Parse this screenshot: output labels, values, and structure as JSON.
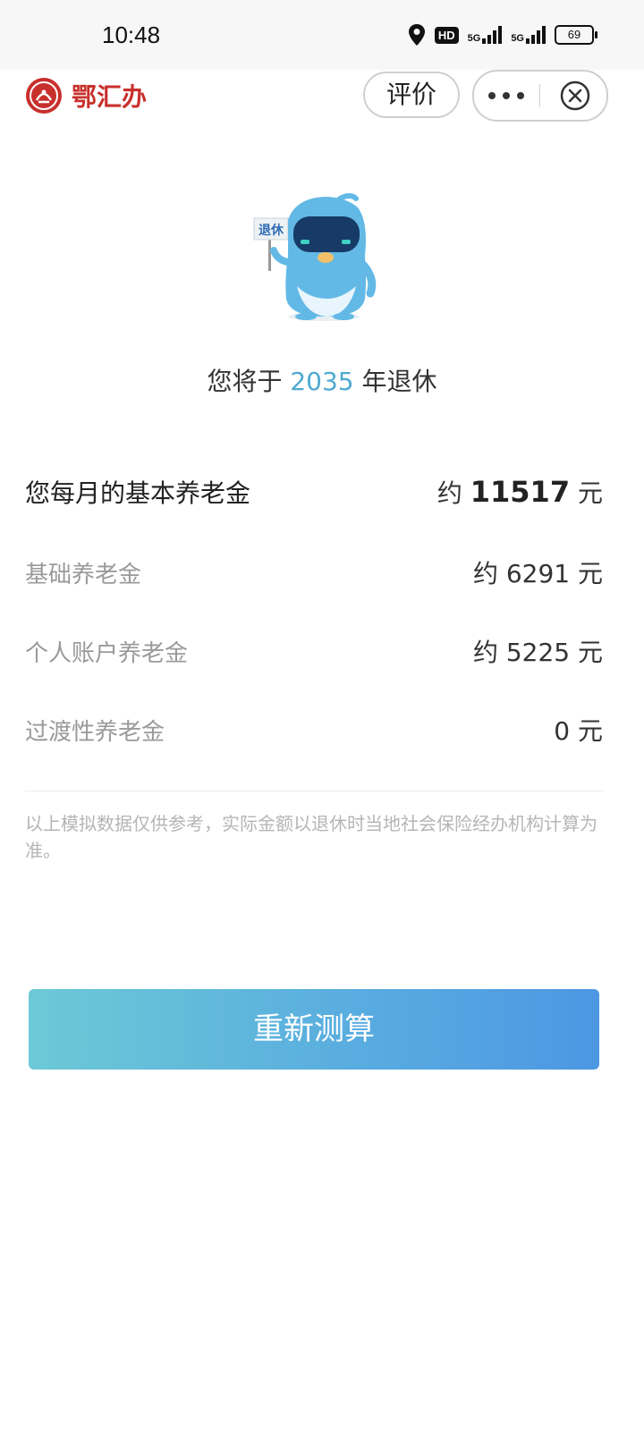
{
  "status_bar": {
    "time": "10:48",
    "hd_label": "HD",
    "signal_1": "5G",
    "signal_2": "5G",
    "battery": "69"
  },
  "header": {
    "app_name": "鄂汇办",
    "rate_button": "评价"
  },
  "mascot": {
    "sign_text": "退休"
  },
  "retire": {
    "prefix": "您将于",
    "year": "2035",
    "suffix": "年退休"
  },
  "pension": {
    "main_label": "您每月的基本养老金",
    "main_prefix": "约",
    "main_amount": "11517",
    "main_unit": "元",
    "rows": [
      {
        "label": "基础养老金",
        "value": "约 6291 元"
      },
      {
        "label": "个人账户养老金",
        "value": "约 5225 元"
      },
      {
        "label": "过渡性养老金",
        "value": "0 元"
      }
    ]
  },
  "note": "以上模拟数据仅供参考，实际金额以退休时当地社会保险经办机构计算为准。",
  "recalc_button": "重新测算",
  "colors": {
    "accent": "#4fa9d0",
    "brand": "#c8302c",
    "button_start": "#6cc9d6",
    "button_end": "#4d97e3"
  }
}
